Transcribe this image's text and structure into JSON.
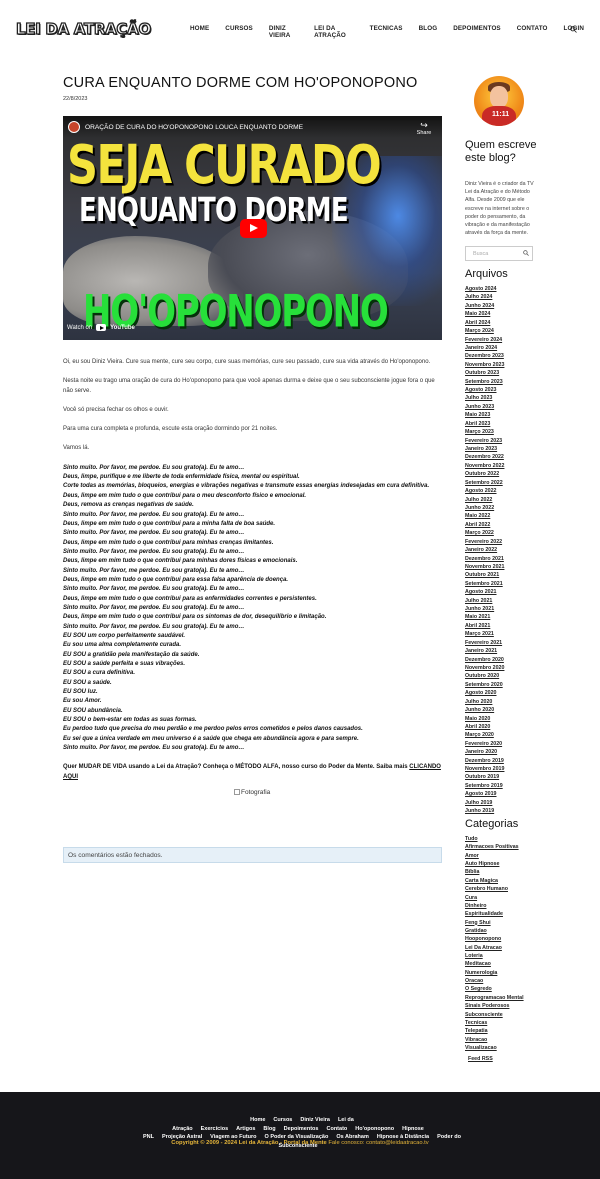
{
  "header": {
    "logo": "LEI DA ATRAÇÃO",
    "nav": [
      "HOME",
      "CURSOS",
      "DINIZ VIEIRA",
      "LEI DA ATRAÇÃO",
      "TECNICAS",
      "BLOG",
      "DEPOIMENTOS",
      "CONTATO",
      "LOGIN"
    ]
  },
  "post": {
    "title": "CURA ENQUANTO DORME COM HO'OPONOPONO",
    "date": "22/8/2023",
    "video": {
      "title": "ORAÇÃO DE CURA DO HO'OPONOPONO LOUCA ENQUANTO DORME",
      "share": "Share",
      "watch_on": "Watch on",
      "youtube": "YouTube",
      "thumb_line1": "SEJA CURADO",
      "thumb_line2": "ENQUANTO DORME",
      "thumb_line3": "HO'OPONOPONO"
    },
    "paragraphs": [
      "Oi, eu sou Diniz Vieira. Cure sua mente, cure seu corpo, cure suas memórias, cure seu passado, cure sua vida através do Ho'oponopono.",
      "Nesta noite eu trago uma oração de cura do Ho'oponopono para que você apenas durma e deixe que o seu subconsciente jogue fora o que não serve.",
      "Você só precisa fechar os olhos e ouvir.",
      "Para uma cura completa e profunda, escute esta oração dormindo por 21 noites.",
      "Vamos lá."
    ],
    "prayer": [
      "Sinto muito. Por favor, me perdoe. Eu sou grato(a). Eu te amo…",
      "Deus, limpe, purifique e me liberte de toda enfermidade física, mental ou espiritual.",
      "Corte todas as memórias, bloqueios, energias e vibrações negativas e transmute essas energias indesejadas em cura definitiva.",
      "Deus, limpe em mim tudo o que contribui para o meu desconforto físico e emocional.",
      "Deus, remova as crenças negativas de saúde.",
      "Sinto muito. Por favor, me perdoe. Eu sou grato(a). Eu te amo…",
      "Deus, limpe em mim tudo o que contribui para a minha falta de boa saúde.",
      "Sinto muito. Por favor, me perdoe. Eu sou grato(a). Eu te amo…",
      "Deus, limpe em mim tudo o que contribui para minhas crenças limitantes.",
      "Sinto muito. Por favor, me perdoe. Eu sou grato(a). Eu te amo…",
      "Deus, limpe em mim tudo o que contribui para minhas dores físicas e emocionais.",
      "Sinto muito. Por favor, me perdoe. Eu sou grato(a). Eu te amo…",
      "Deus, limpe em mim tudo o que contribui para essa falsa aparência de doença.",
      "Sinto muito. Por favor, me perdoe. Eu sou grato(a). Eu te amo…",
      "Deus, limpe em mim tudo o que contribui para as enfermidades correntes e persistentes.",
      "Sinto muito. Por favor, me perdoe. Eu sou grato(a). Eu te amo…",
      "Deus, limpe em mim tudo o que contribui para os sintomas de dor, desequilíbrio e limitação.",
      "Sinto muito. Por favor, me perdoe. Eu sou grato(a). Eu te amo…",
      "EU SOU um corpo perfeitamente saudável.",
      "Eu sou uma alma completamente curada.",
      "EU SOU a gratidão pela manifestação da saúde.",
      "EU SOU a saúde perfeita e suas vibrações.",
      "EU SOU a cura definitiva.",
      "EU SOU a saúde.",
      "EU SOU luz.",
      "Eu sou Amor.",
      "EU SOU abundância.",
      "EU SOU o bem-estar em todas as suas formas.",
      "Eu perdoo tudo que precisa do meu perdão e me perdoo pelos erros cometidos e pelos danos causados.",
      "Eu sei que a única verdade em meu universo é a saúde que chega em abundância agora e para sempre.",
      "Sinto muito. Por favor, me perdoe. Eu sou grato(a). Eu te amo…"
    ],
    "cta_text": "Quer MUDAR DE VIDA usando a Lei da Atração? Conheça o MÉTODO ALFA, nosso curso do Poder da Mente. Saiba mais ",
    "cta_link": "CLICANDO AQUI",
    "image_alt": "Fotografia",
    "comments_closed": "Os comentários estão fechados."
  },
  "sidebar": {
    "avatar_number": "11:11",
    "about_title": "Quem escreve este blog?",
    "about_text": "Diniz Vieira é o criador da TV Lei da Atração e do Método Alfa. Desde 2009 que ele escreve na internet sobre o poder do pensamento, da vibração e da manifestação através da força da mente.",
    "search_placeholder": "Busca",
    "archives_title": "Arquivos",
    "archives": [
      "Agosto 2024",
      "Julho 2024",
      "Junho 2024",
      "Maio 2024",
      "Abril 2024",
      "Março 2024",
      "Fevereiro 2024",
      "Janeiro 2024",
      "Dezembro 2023",
      "Novembro 2023",
      "Outubro 2023",
      "Setembro 2023",
      "Agosto 2023",
      "Julho 2023",
      "Junho 2023",
      "Maio 2023",
      "Abril 2023",
      "Março 2023",
      "Fevereiro 2023",
      "Janeiro 2023",
      "Dezembro 2022",
      "Novembro 2022",
      "Outubro 2022",
      "Setembro 2022",
      "Agosto 2022",
      "Julho 2022",
      "Junho 2022",
      "Maio 2022",
      "Abril 2022",
      "Março 2022",
      "Fevereiro 2022",
      "Janeiro 2022",
      "Dezembro 2021",
      "Novembro 2021",
      "Outubro 2021",
      "Setembro 2021",
      "Agosto 2021",
      "Julho 2021",
      "Junho 2021",
      "Maio 2021",
      "Abril 2021",
      "Março 2021",
      "Fevereiro 2021",
      "Janeiro 2021",
      "Dezembro 2020",
      "Novembro 2020",
      "Outubro 2020",
      "Setembro 2020",
      "Agosto 2020",
      "Julho 2020",
      "Junho 2020",
      "Maio 2020",
      "Abril 2020",
      "Março 2020",
      "Fevereiro 2020",
      "Janeiro 2020",
      "Dezembro 2019",
      "Novembro 2019",
      "Outubro 2019",
      "Setembro 2019",
      "Agosto 2019",
      "Julho 2019",
      "Junho 2019"
    ],
    "categories_title": "Categorias",
    "categories": [
      "Tudo",
      "Afirmacoes Positivas",
      "Amor",
      "Auto Hipnose",
      "Bíblia",
      "Carta Magica",
      "Cerebro Humano",
      "Cura",
      "Dinheiro",
      "Espiritualidade",
      "Feng Shui",
      "Gratidao",
      "Hooponopono",
      "Lei Da Atracao",
      "Loteria",
      "Meditacao",
      "Numerologia",
      "Oracao",
      "O Segredo",
      "Reprogramacao Mental",
      "Sinais Poderosos",
      "Subconsciente",
      "Tecnicas",
      "Telepatia",
      "Vibracao",
      "Visualizacao"
    ],
    "feed": "Feed RSS"
  },
  "footer": {
    "links_row1": [
      "Home",
      "Cursos",
      "Diniz Vieira",
      "Lei da Atração",
      "Exercícios",
      "Artigos",
      "Blog",
      "Depoimentos",
      "Contato",
      "Ho'oponopono",
      "Hipnose"
    ],
    "links_row2": [
      "PNL",
      "Projeção Astral",
      "Viagem ao Futuro",
      "O Poder da Visualização",
      "Os Abraham",
      "Hipnose à Distância",
      "Poder do Subconsciente"
    ],
    "copyright": "Copyright © 2009 - 2024 Lei da Atração - Portal da Mente",
    "contact": "Fale conosco: contato@leidaatracao.tv"
  }
}
